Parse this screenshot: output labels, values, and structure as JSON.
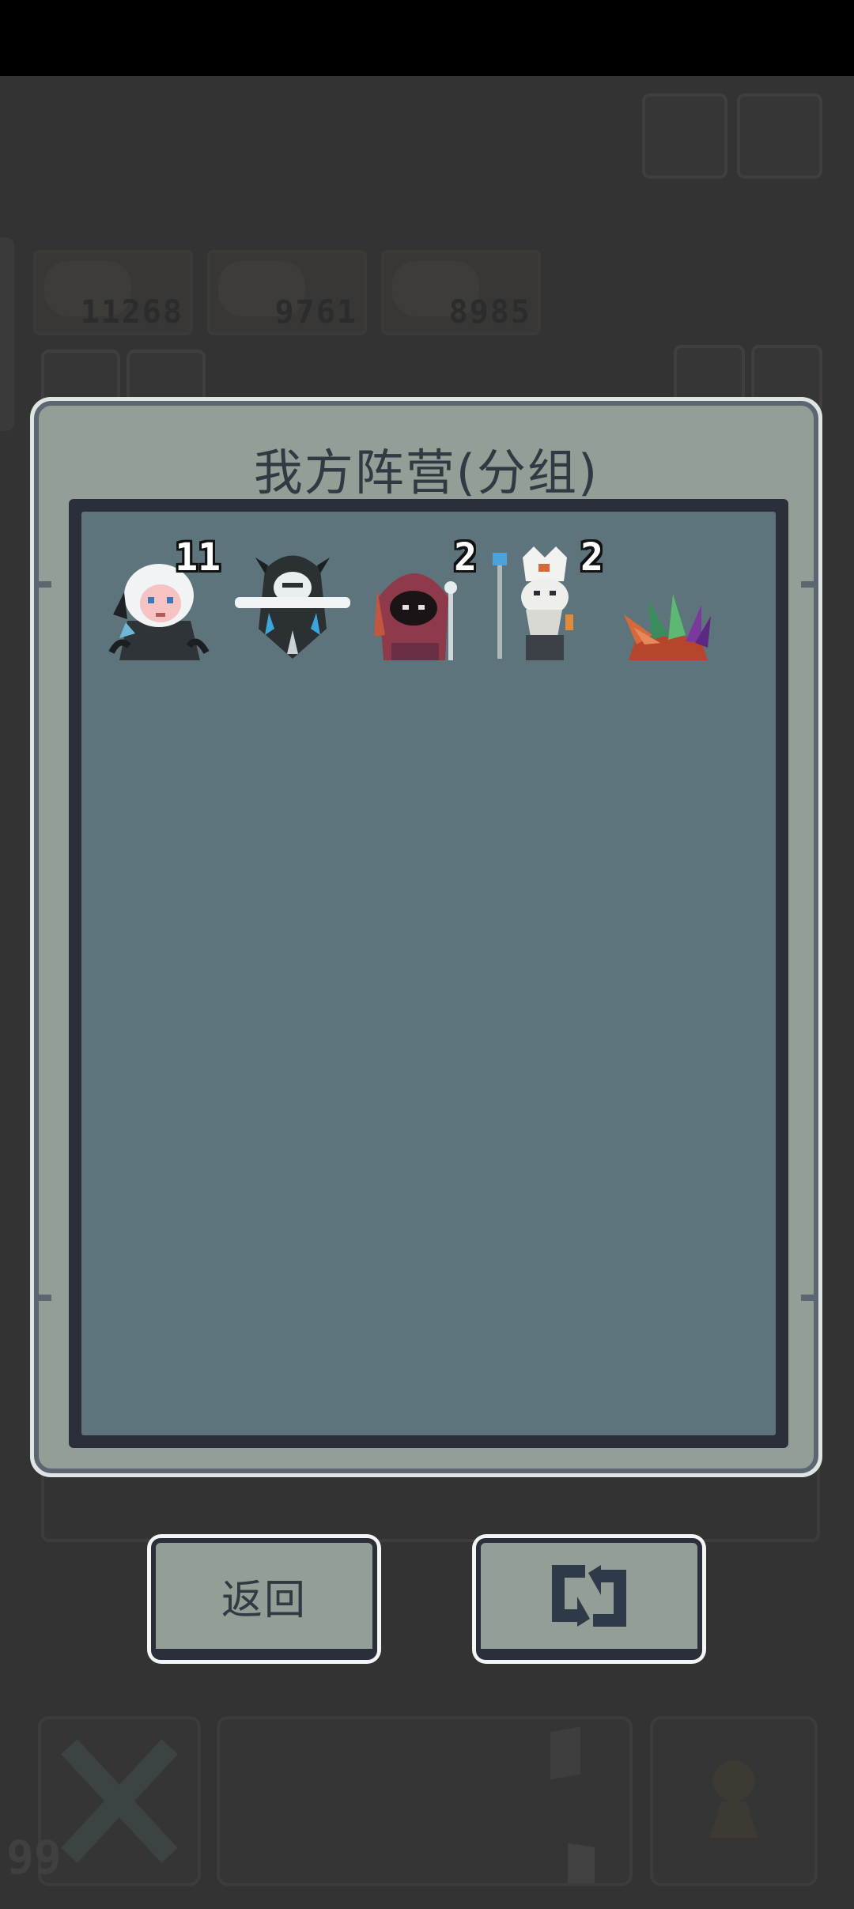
{
  "background": {
    "scores": [
      "11268",
      "9761",
      "8985"
    ],
    "remaining_count": "99"
  },
  "modal": {
    "title": "我方阵营(分组)",
    "units": [
      {
        "name": "white-haired-witch",
        "count": "11"
      },
      {
        "name": "hooded-ghost",
        "count": ""
      },
      {
        "name": "red-cloaked-cultist",
        "count": "2"
      },
      {
        "name": "white-priest",
        "count": "2"
      },
      {
        "name": "crystal-plant",
        "count": ""
      }
    ]
  },
  "buttons": {
    "back_label": "返回",
    "swap_icon": "swap-arrows-icon"
  },
  "colors": {
    "panel": "#939e96",
    "inner": "#5e747c",
    "border": "#2b2f3a"
  }
}
